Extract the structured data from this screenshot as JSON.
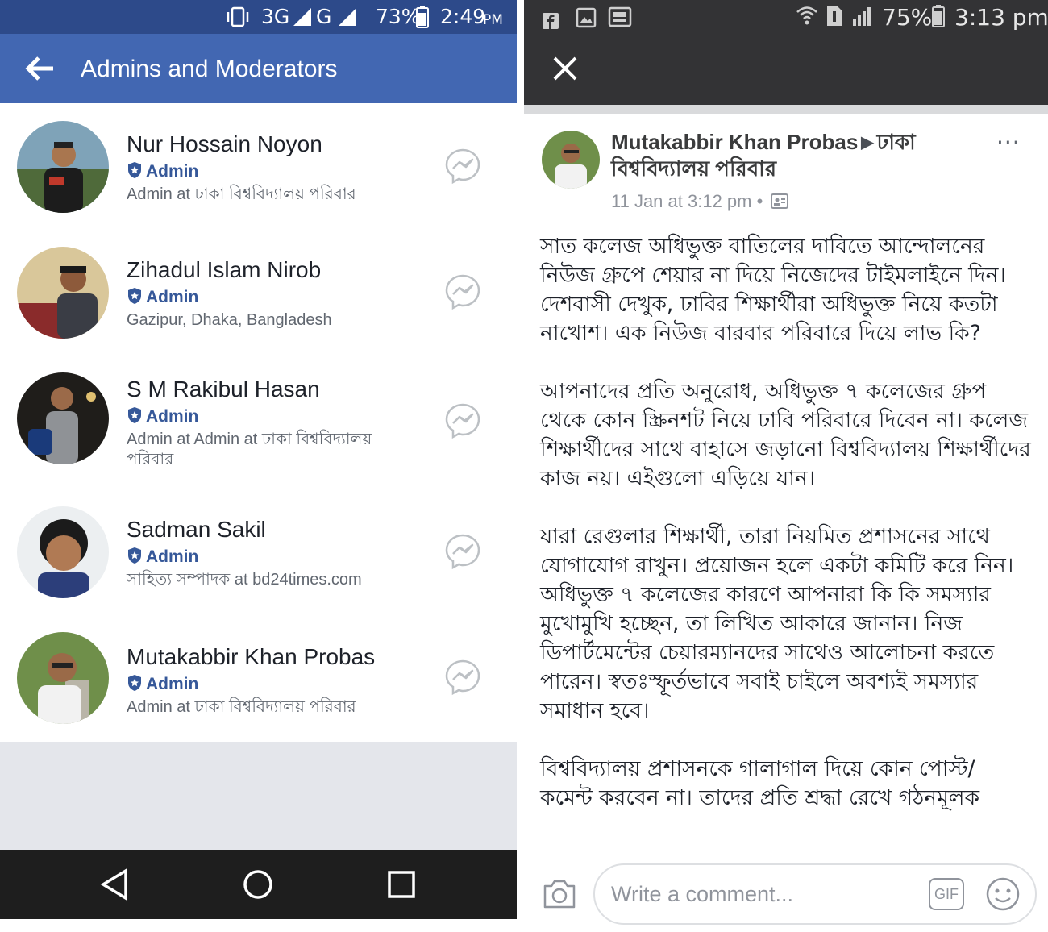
{
  "left": {
    "status_bar": {
      "network": "3G",
      "network2": "G",
      "battery": "73%",
      "time": "2:49",
      "ampm": "PM"
    },
    "header": {
      "title": "Admins and Moderators"
    },
    "members": [
      {
        "name": "Nur Hossain Noyon",
        "role": "Admin",
        "subtitle": "Admin at ঢাকা বিশ্ববিদ্যালয় পরিবার"
      },
      {
        "name": "Zihadul Islam Nirob",
        "role": "Admin",
        "subtitle": "Gazipur, Dhaka, Bangladesh"
      },
      {
        "name": "S M Rakibul Hasan",
        "role": "Admin",
        "subtitle": "Admin at Admin at ঢাকা বিশ্ববিদ্যালয় পরিবার"
      },
      {
        "name": "Sadman Sakil",
        "role": "Admin",
        "subtitle": "সাহিত্য সম্পাদক at bd24times.com"
      },
      {
        "name": "Mutakabbir Khan Probas",
        "role": "Admin",
        "subtitle": "Admin at ঢাকা বিশ্ববিদ্যালয় পরিবার"
      }
    ]
  },
  "right": {
    "status_bar": {
      "battery": "75%",
      "time": "3:13 pm"
    },
    "post": {
      "author": "Mutakabbir Khan Probas",
      "group": "ঢাকা বিশ্ববিদ্যালয় পরিবার",
      "timestamp": "11 Jan at 3:12 pm",
      "separator": "•",
      "more": "···",
      "paragraphs": [
        "সাত কলেজ অধিভুক্ত বাতিলের দাবিতে আন্দোলনের নিউজ গ্রুপে শেয়ার না দিয়ে নিজেদের টাইমলাইনে দিন। দেশবাসী দেখুক, ঢাবির শিক্ষার্থীরা অধিভুক্ত নিয়ে কতটা নাখোশ। এক নিউজ বারবার পরিবারে দিয়ে লাভ কি?",
        "আপনাদের প্রতি অনুরোধ, অধিভুক্ত ৭ কলেজের গ্রুপ থেকে কোন স্ক্রিনশট নিয়ে ঢাবি পরিবারে দিবেন না। কলেজ শিক্ষার্থীদের সাথে বাহাসে জড়ানো বিশ্ববিদ্যালয় শিক্ষার্থীদের কাজ নয়। এইগুলো এড়িয়ে যান।",
        "যারা রেগুলার শিক্ষার্থী, তারা নিয়মিত প্রশাসনের সাথে যোগাযোগ রাখুন। প্রয়োজন হলে একটা কমিটি করে নিন। অধিভুক্ত ৭ কলেজের কারণে আপনারা কি কি সমস্যার মুখোমুখি হচ্ছেন, তা লিখিত আকারে জানান। নিজ ডিপার্টমেন্টের চেয়ারম্যানদের সাথেও আলোচনা করতে পারেন। স্বতঃস্ফূর্তভাবে সবাই চাইলে অবশ্যই সমস্যার সমাধান হবে।",
        "বিশ্ববিদ্যালয় প্রশাসনকে গালাগাল দিয়ে কোন পোস্ট/ কমেন্ট করবেন না। তাদের প্রতি শ্রদ্ধা রেখে গঠনমূলক"
      ]
    },
    "comment_bar": {
      "placeholder": "Write a comment...",
      "gif_label": "GIF"
    }
  },
  "colors": {
    "fb_blue": "#4267b2",
    "fb_dark_blue": "#2d4a8a",
    "link_blue": "#365899",
    "dark_bar": "#333335",
    "nav_bar": "#1e1e1e"
  },
  "icons": [
    "back-arrow-icon",
    "admin-shield-icon",
    "messenger-icon",
    "close-icon",
    "camera-icon",
    "gif-icon",
    "emoji-icon",
    "privacy-icon",
    "more-icon",
    "nav-back-icon",
    "nav-home-icon",
    "nav-recents-icon"
  ]
}
